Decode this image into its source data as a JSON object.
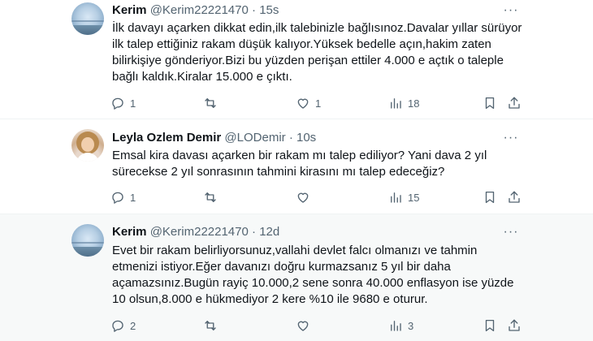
{
  "tweets": [
    {
      "name": "Kerim",
      "handle": "@Kerim22221470",
      "separator": "·",
      "time": "15s",
      "more": "···",
      "lines": [
        "İlk davayı açarken dikkat edin,ilk talebinizle bağlısınoz.Davalar yıllar sürüyor",
        "ilk talep ettiğiniz rakam düşük kalıyor.Yüksek bedelle açın,hakim zaten",
        "bilirkişiye gönderiyor.Bizi bu yüzden perişan ettiler 4.000 e açtık o taleple",
        "bağlı kaldık.Kiralar 15.000 e çıktı."
      ],
      "replies": "1",
      "retweets": "",
      "likes": "1",
      "views": "18"
    },
    {
      "name": "Leyla Ozlem Demir",
      "handle": "@LODemir",
      "separator": "·",
      "time": "10s",
      "more": "···",
      "lines": [
        "Emsal kira davası açarken bir rakam mı talep ediliyor? Yani dava 2 yıl",
        "sürecekse 2 yıl sonrasının tahmini kirasını mı talep edeceğiz?"
      ],
      "replies": "1",
      "retweets": "",
      "likes": "",
      "views": "15"
    },
    {
      "name": "Kerim",
      "handle": "@Kerim22221470",
      "separator": "·",
      "time": "12d",
      "more": "···",
      "lines": [
        "Evet bir rakam belirliyorsunuz,vallahi devlet falcı olmanızı ve tahmin",
        "etmenizi istiyor.Eğer davanızı doğru kurmazsanız 5 yıl bir daha",
        "açamazsınız.Bugün rayiç 10.000,2 sene sonra 40.000 enflasyon ise yüzde",
        "10 olsun,8.000 e hükmediyor 2 kere %10 ile 9680 e oturur."
      ],
      "replies": "2",
      "retweets": "",
      "likes": "",
      "views": "3"
    }
  ],
  "icons": {
    "reply": "reply-icon",
    "retweet": "retweet-icon",
    "like": "like-icon",
    "views": "views-icon",
    "bookmark": "bookmark-icon",
    "share": "share-icon"
  },
  "colors": {
    "text": "#0f1419",
    "muted": "#536471",
    "divider": "#eff3f4",
    "highlight_bg": "#f7f9f9"
  }
}
